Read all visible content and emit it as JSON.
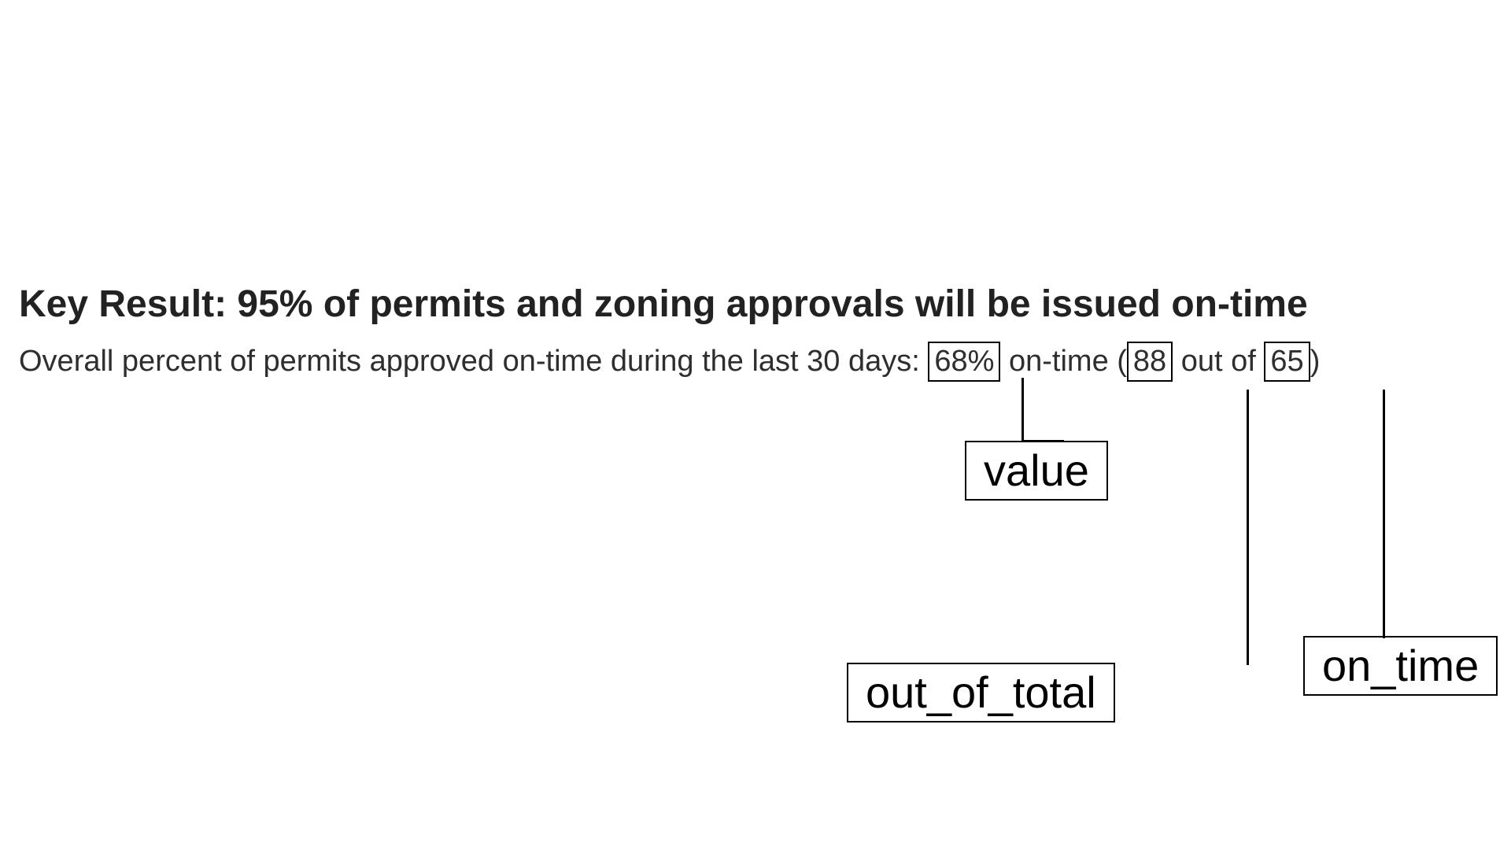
{
  "title": "Key Result: 95% of permits and zoning approvals will be issued on-time",
  "subtitle": {
    "prefix": "Overall percent of permits approved on-time during the last 30 days:",
    "value": "68%",
    "mid1": "on-time (",
    "out_of_total": "88",
    "mid2": "out of",
    "on_time": "65",
    "suffix": ")"
  },
  "labels": {
    "value": "value",
    "out_of_total": "out_of_total",
    "on_time": "on_time"
  }
}
